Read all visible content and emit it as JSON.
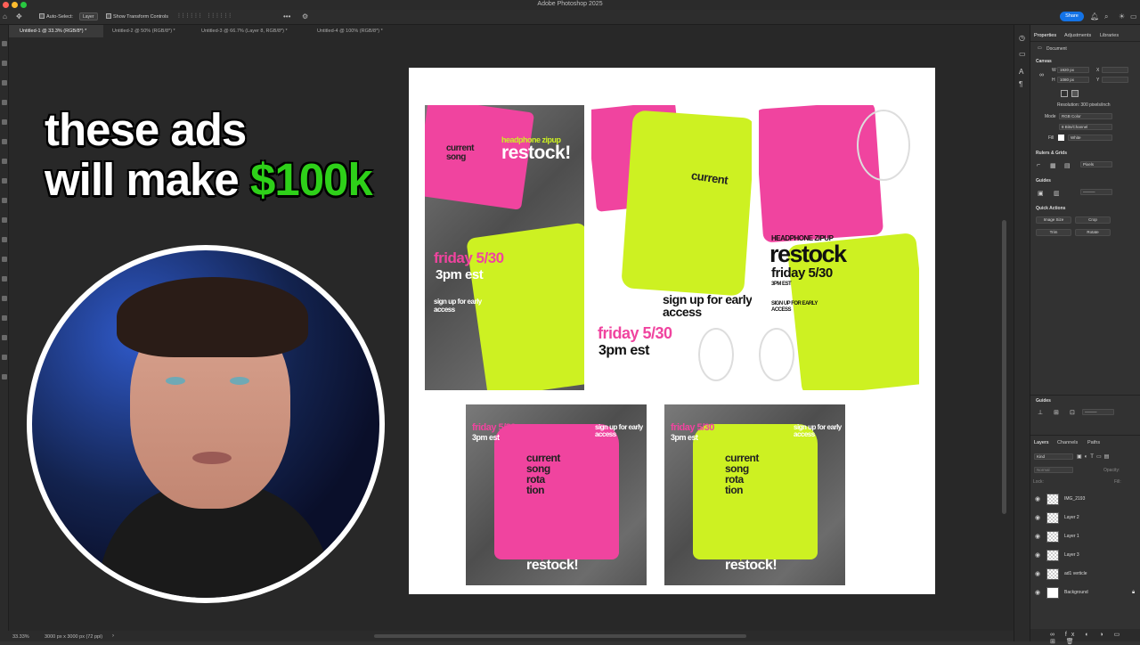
{
  "app": {
    "title": "Adobe Photoshop 2025"
  },
  "options_bar": {
    "auto_select_label": "Auto-Select:",
    "auto_select_value": "Layer",
    "transform_controls_label": "Show Transform Controls",
    "share_label": "Share"
  },
  "tabs": [
    {
      "label": "Untitled-1 @ 33.3% (RGB/8*) *"
    },
    {
      "label": "Untitled-2 @ 50% (RGB/8*) *"
    },
    {
      "label": "Untitled-3 @ 66.7% (Layer 8, RGB/8*) *"
    },
    {
      "label": "Untitled-4 @ 100% (RGB/8*) *"
    }
  ],
  "status": {
    "zoom": "33.33%",
    "doc_info": "3000 px x 3000 px (72 ppi)"
  },
  "overlay": {
    "line1": "these ads",
    "line2_prefix": "will make ",
    "line2_money": "$100k"
  },
  "properties": {
    "tabs": [
      "Properties",
      "Adjustments",
      "Libraries"
    ],
    "doc_label": "Document",
    "canvas_label": "Canvas",
    "w_label": "W",
    "w_value": "1920 px",
    "x_label": "X",
    "h_label": "H",
    "h_value": "1080 px",
    "y_label": "Y",
    "resolution": "Resolution: 300 pixels/inch",
    "mode_label": "Mode",
    "mode_value": "RGB Color",
    "bits_value": "8 Bits/Channel",
    "fill_label": "Fill",
    "fill_value": "White",
    "rulers_label": "Rulers & Grids",
    "units_value": "Pixels",
    "guides_label": "Guides",
    "quick_actions_label": "Quick Actions",
    "quick_actions": [
      "Image Size",
      "Crop",
      "Trim",
      "Rotate"
    ],
    "guides2_label": "Guides"
  },
  "layers": {
    "tabs": [
      "Layers",
      "Channels",
      "Paths"
    ],
    "kind_value": "Kind",
    "blend_value": "Normal",
    "opacity_label": "Opacity:",
    "lock_label": "Lock:",
    "fill_label": "Fill:",
    "items": [
      {
        "name": "IMG_2193"
      },
      {
        "name": "Layer 2"
      },
      {
        "name": "Layer 1"
      },
      {
        "name": "Layer 3"
      },
      {
        "name": "ad1 verticle"
      },
      {
        "name": "Background"
      }
    ]
  },
  "ads": {
    "restock_caption": "headphone zipup",
    "restock_word": "restock!",
    "date": "friday 5/30",
    "time": "3pm est",
    "signup": "sign up for early access",
    "big_caps": "HEADPHONE ZIPUP",
    "big_restock": "restock",
    "big_date": "friday 5/30",
    "big_time": "3PM EST",
    "big_signup": "SIGN UP FOR EARLY ACCESS",
    "graphic_words": [
      "current",
      "song",
      "rota",
      "tion"
    ]
  },
  "colors": {
    "pink": "#f0449f",
    "lime": "#cdf122",
    "money": "#2ed019",
    "share": "#1473e6"
  }
}
